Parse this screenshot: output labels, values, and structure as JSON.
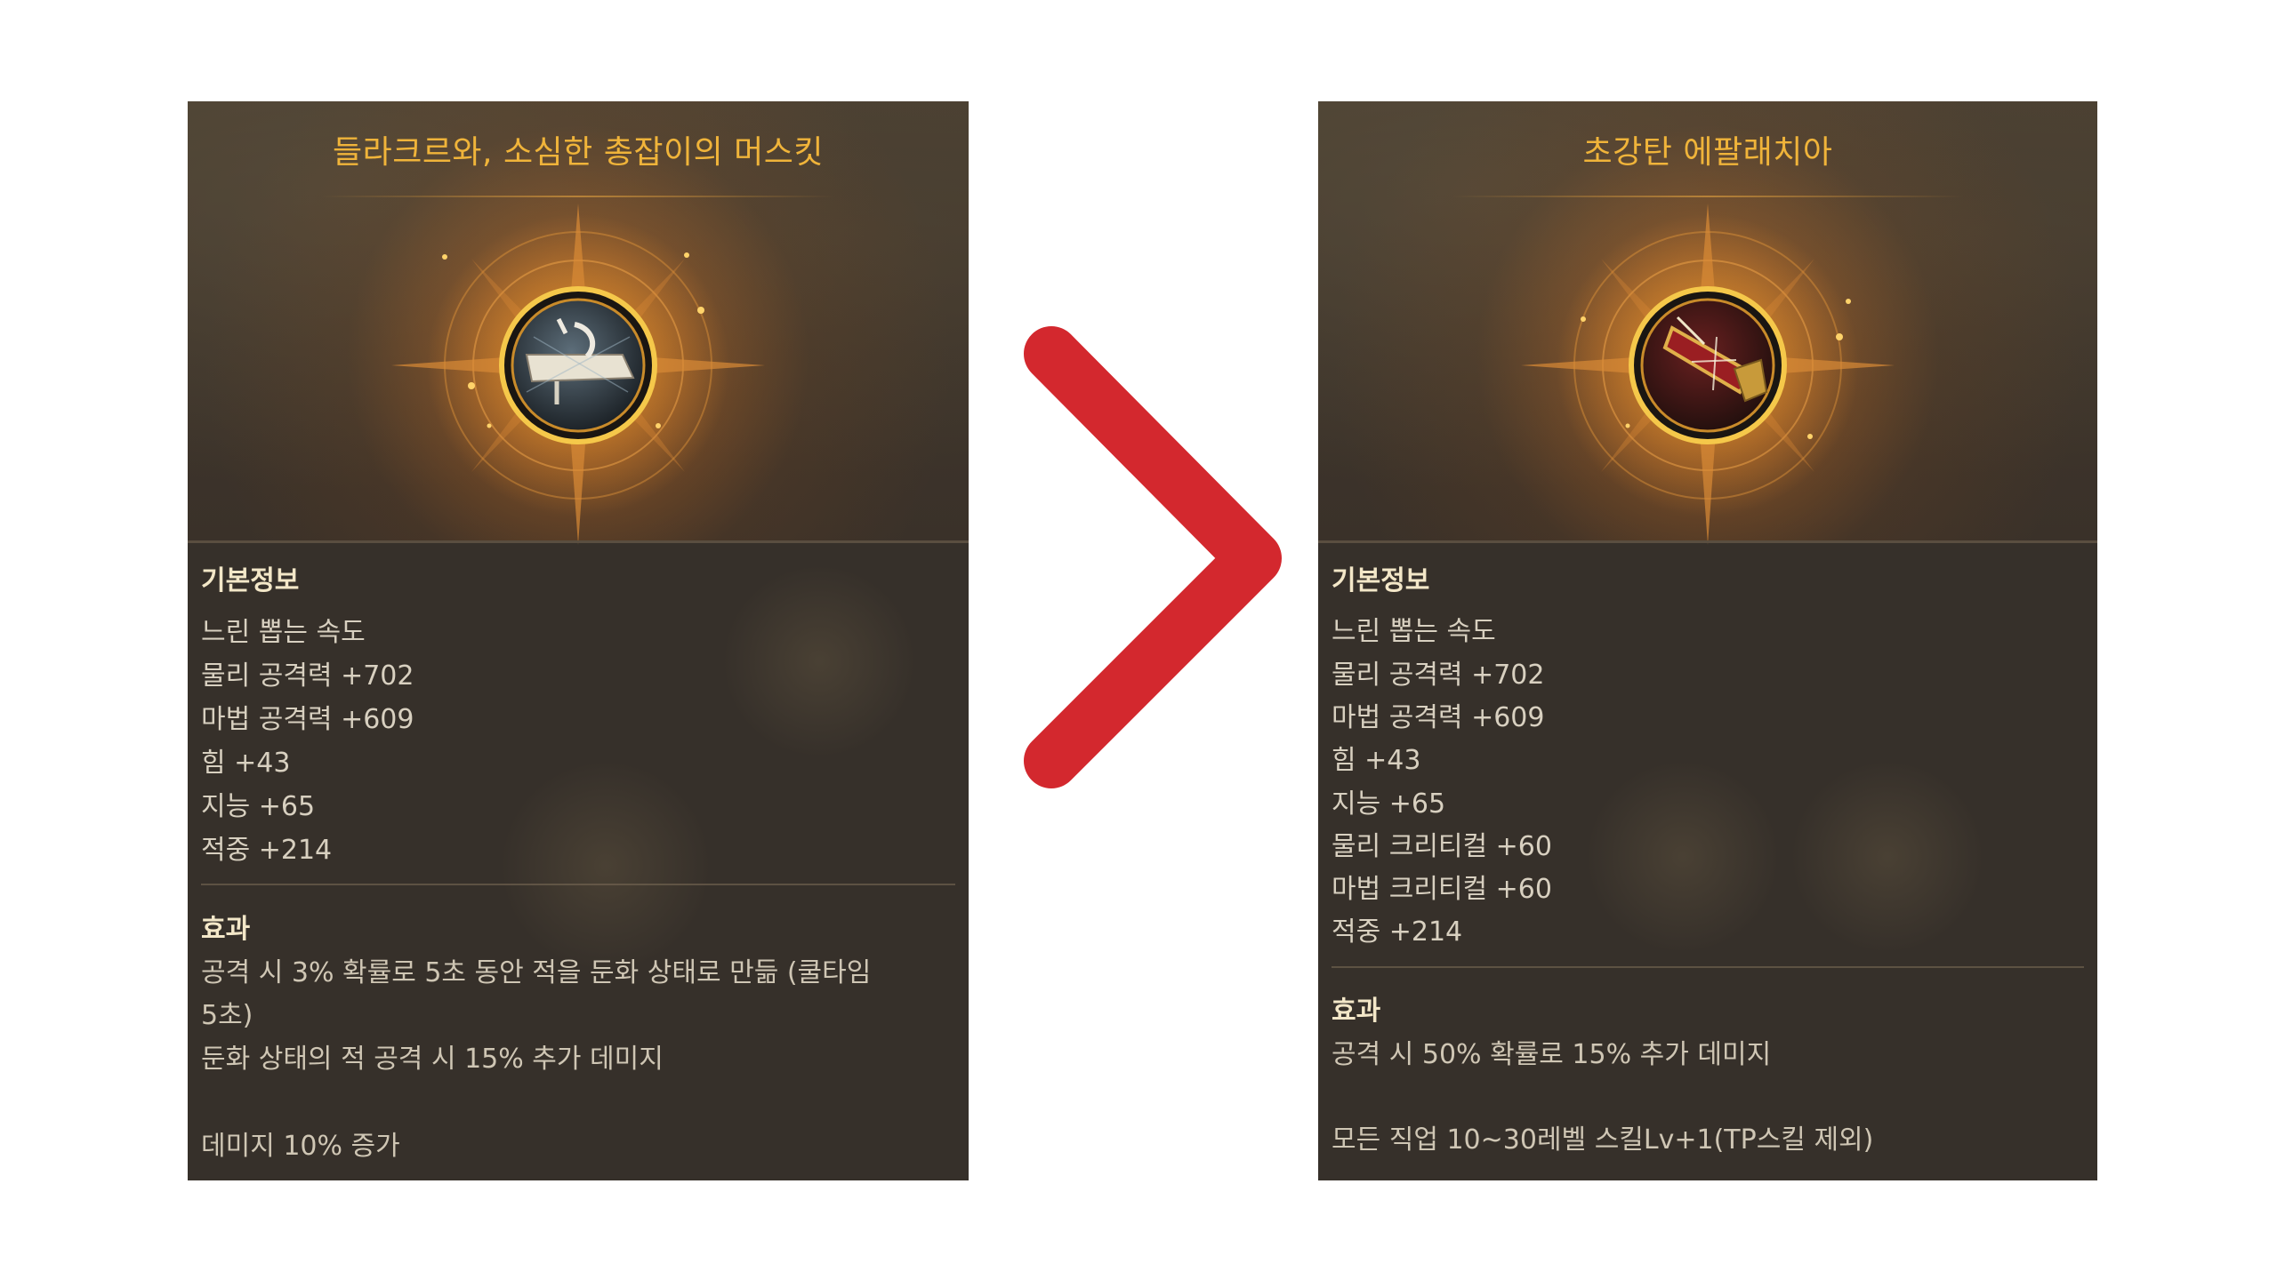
{
  "left_card": {
    "title": "들라크르와, 소심한 총잡이의 머스킷",
    "icon": "musket-icon",
    "basic_info_header": "기본정보",
    "stats": [
      "느린 뽑는 속도",
      "물리 공격력 +702",
      "마법 공격력 +609",
      "힘 +43",
      "지능 +65",
      "적중 +214"
    ],
    "effect_header": "효과",
    "effects": [
      "공격 시 3% 확률로 5초 동안 적을 둔화 상태로 만듦 (쿨타임 5초)",
      "둔화 상태의 적 공격 시 15% 추가 데미지",
      "데미지 10% 증가"
    ]
  },
  "right_card": {
    "title": "초강탄 에팔래치아",
    "icon": "red-gun-icon",
    "basic_info_header": "기본정보",
    "stats": [
      "느린 뽑는 속도",
      "물리 공격력 +702",
      "마법 공격력 +609",
      "힘 +43",
      "지능 +65",
      "물리 크리티컬 +60",
      "마법 크리티컬 +60",
      "적중 +214"
    ],
    "effect_header": "효과",
    "effects": [
      "공격 시 50% 확률로 15% 추가 데미지",
      "모든 직업 10~30레벨 스킬Lv+1(TP스킬 제외)"
    ]
  },
  "comparison_arrow": "chevron-right-icon",
  "colors": {
    "title_gold": "#f0b43a",
    "arrow_red": "#d3282e",
    "panel_bg": "#36302a"
  }
}
